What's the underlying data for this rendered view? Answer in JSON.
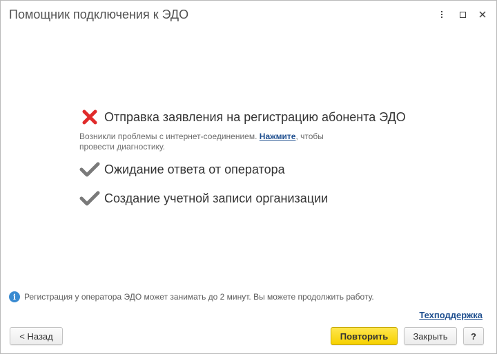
{
  "window": {
    "title": "Помощник подключения к ЭДО"
  },
  "steps": [
    {
      "label": "Отправка заявления на регистрацию абонента ЭДО",
      "status": "error",
      "status_icon": "cross-icon",
      "status_color": "#e02b2b",
      "error_text_before": "Возникли проблемы с интернет-соединением. ",
      "error_link": "Нажмите",
      "error_text_after": ", чтобы провести диагностику."
    },
    {
      "label": "Ожидание ответа от оператора",
      "status": "done",
      "status_icon": "checkmark-icon",
      "status_color": "#7a7a7a"
    },
    {
      "label": "Создание учетной записи организации",
      "status": "done",
      "status_icon": "checkmark-icon",
      "status_color": "#7a7a7a"
    }
  ],
  "info": {
    "icon": "info-icon",
    "icon_glyph": "i",
    "text": "Регистрация у оператора ЭДО может занимать до 2 минут. Вы можете продолжить работу."
  },
  "support_link": "Техподдержка",
  "buttons": {
    "back": "< Назад",
    "retry": "Повторить",
    "close": "Закрыть",
    "help": "?"
  },
  "colors": {
    "accent_button": "#f6d100",
    "link": "#1f4f8f",
    "info": "#3a8bd1"
  }
}
